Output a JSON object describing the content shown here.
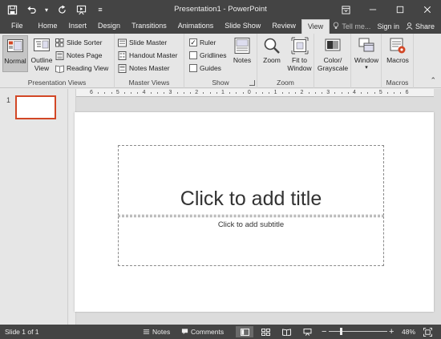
{
  "app": {
    "title": "Presentation1 - PowerPoint",
    "accent": "#d24726"
  },
  "qat": {
    "icons": [
      "save-icon",
      "undo-icon",
      "redo-icon",
      "slideshow-from-start-icon",
      "customize-qat-icon"
    ]
  },
  "tabs": [
    {
      "label": "File"
    },
    {
      "label": "Home"
    },
    {
      "label": "Insert"
    },
    {
      "label": "Design"
    },
    {
      "label": "Transitions"
    },
    {
      "label": "Animations"
    },
    {
      "label": "Slide Show"
    },
    {
      "label": "Review"
    },
    {
      "label": "View"
    }
  ],
  "active_tab": "View",
  "tabbar_right": {
    "tell_me": "Tell me...",
    "sign_in": "Sign in",
    "share": "Share"
  },
  "ribbon": {
    "presentation_views": {
      "label": "Presentation Views",
      "normal": "Normal",
      "outline_view": "Outline View",
      "slide_sorter": "Slide Sorter",
      "notes_page": "Notes Page",
      "reading_view": "Reading View"
    },
    "master_views": {
      "label": "Master Views",
      "slide_master": "Slide Master",
      "handout_master": "Handout Master",
      "notes_master": "Notes Master"
    },
    "show": {
      "label": "Show",
      "ruler": "Ruler",
      "ruler_checked": true,
      "gridlines": "Gridlines",
      "gridlines_checked": false,
      "guides": "Guides",
      "guides_checked": false,
      "notes": "Notes"
    },
    "zoom": {
      "label": "Zoom",
      "zoom": "Zoom",
      "fit_to_window": "Fit to Window"
    },
    "color": {
      "color_grayscale": "Color/ Grayscale"
    },
    "window": {
      "window": "Window"
    },
    "macros": {
      "label": "Macros",
      "macros": "Macros"
    }
  },
  "slides_panel": {
    "slide_number": "1"
  },
  "ruler": {
    "labels": [
      "6",
      "5",
      "4",
      "3",
      "2",
      "1",
      "0",
      "1",
      "2",
      "3",
      "4",
      "5",
      "6"
    ]
  },
  "slide": {
    "title_placeholder": "Click to add title",
    "subtitle_placeholder": "Click to add subtitle"
  },
  "statusbar": {
    "slide_info": "Slide 1 of 1",
    "notes": "Notes",
    "comments": "Comments",
    "zoom_percent": "48%",
    "zoom_level": 0.48
  }
}
